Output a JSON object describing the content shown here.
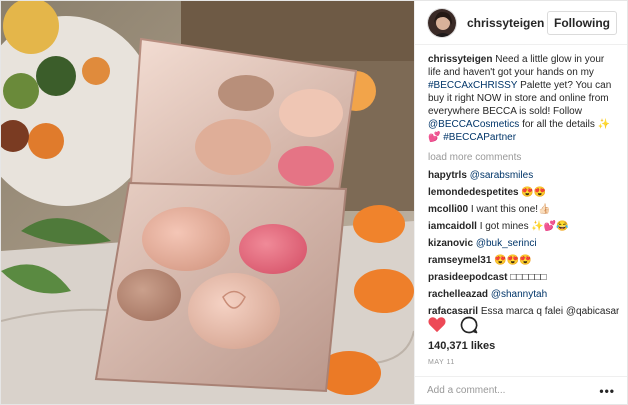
{
  "post": {
    "username": "chrissyteigen",
    "follow_label": "Following",
    "caption": {
      "user": "chrissyteigen",
      "text_1": "Need a little glow in your life and haven't got your hands on my",
      "tag_1": "#BECCAxCHRISSY",
      "text_2": "Palette yet? You can buy it right NOW in store and online from everywhere BECCA is sold! Follow",
      "tag_2": "@BECCACosmetics",
      "text_3": "for all the details ✨💕",
      "tag_3": "#BECCAPartner"
    },
    "load_more": "load more comments",
    "comments": [
      {
        "user": "hapytrls",
        "text": "@sarabsmiles"
      },
      {
        "user": "lemondedespetites",
        "text": "😍😍"
      },
      {
        "user": "mcolli00",
        "text": "I want this one!👍🏻"
      },
      {
        "user": "iamcaidoll",
        "text": "I got mines ✨💕😂"
      },
      {
        "user": "kizanovic",
        "text": "@buk_serinci"
      },
      {
        "user": "ramseymel31",
        "text": "😍😍😍"
      },
      {
        "user": "prasideepodcast",
        "text": "□□□□□□"
      },
      {
        "user": "rachelleazad",
        "text": "@shannytah"
      },
      {
        "user": "rafacasaril",
        "text": "Essa marca q falei @qabicasaril"
      }
    ],
    "likes": "140,371 likes",
    "date": "MAY 11",
    "add_comment_placeholder": "Add a comment...",
    "more_options": "•••",
    "icons": {
      "like": "heart-icon",
      "comment": "comment-icon",
      "more": "more-options-icon"
    },
    "colors": {
      "like": "#ed4956",
      "link": "#003569",
      "muted": "#999999"
    }
  }
}
